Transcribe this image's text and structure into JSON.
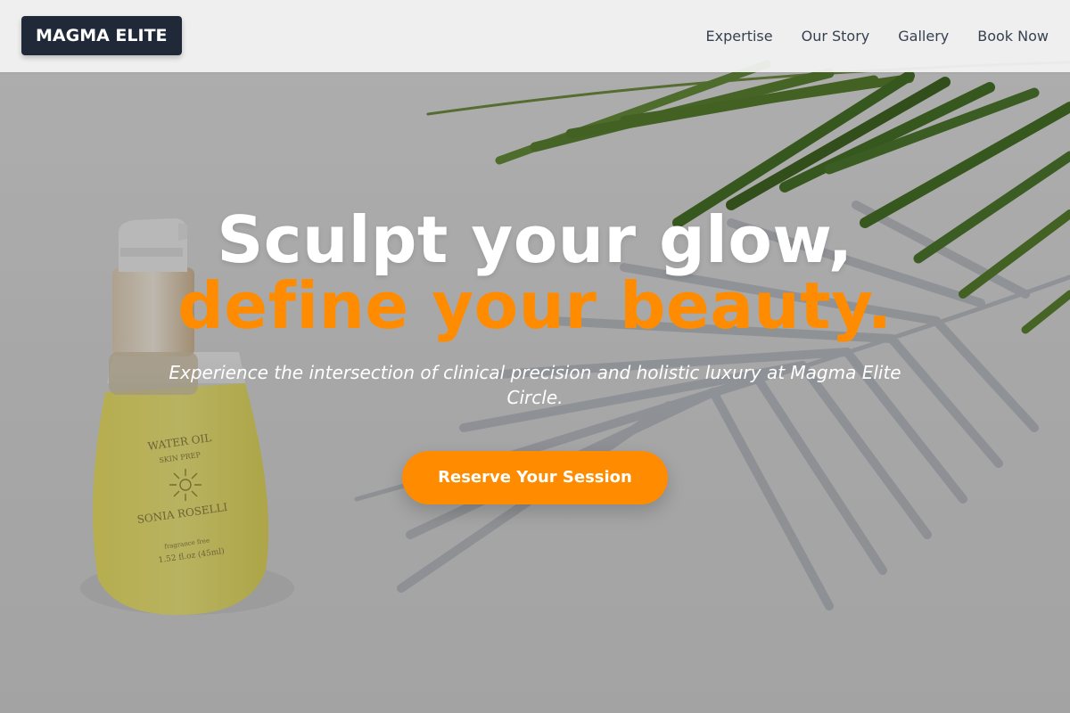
{
  "brand": {
    "logo_text": "MAGMA ELITE"
  },
  "nav": {
    "links": [
      "Expertise",
      "Our Story",
      "Gallery",
      "Book Now"
    ]
  },
  "hero": {
    "headline_line1": "Sculpt your glow,",
    "headline_line2": "define your beauty.",
    "subheadline": "Experience the intersection of clinical precision and holistic luxury at Magma Elite Circle.",
    "cta_label": "Reserve Your Session",
    "product_label": {
      "line1": "WATER OIL",
      "line2": "SKIN PREP",
      "line3": "SONIA ROSELLI",
      "line4": "fragrance free",
      "line5": "1.52 fl.oz (45ml)"
    }
  },
  "colors": {
    "accent": "#ff8c00",
    "logo_bg": "#1f2937",
    "nav_text": "#374151",
    "headline_white": "#ffffff"
  }
}
